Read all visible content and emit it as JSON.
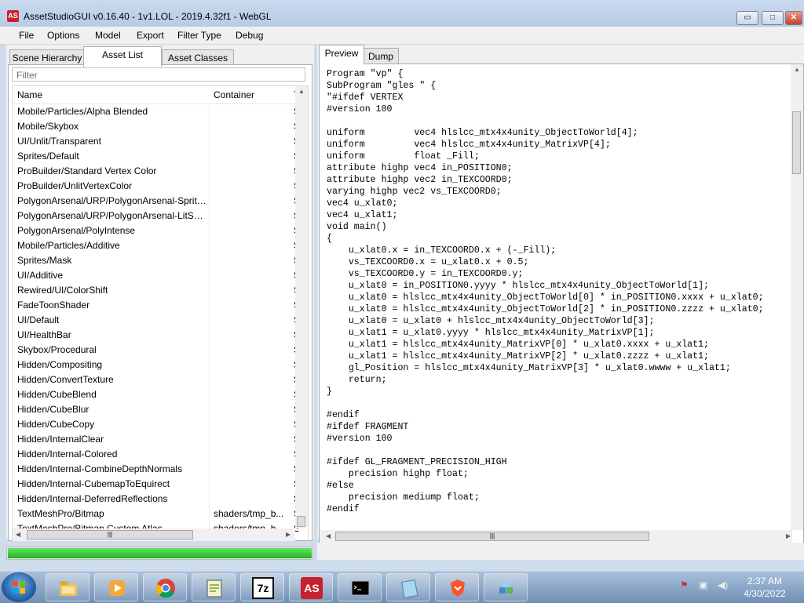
{
  "window": {
    "title": "AssetStudioGUI v0.16.40 - 1v1.LOL - 2019.4.32f1 - WebGL",
    "app_icon_text": "AS",
    "controls": {
      "minimize": "▭",
      "maximize": "□",
      "close": "✕"
    }
  },
  "menu": [
    "File",
    "Options",
    "Model",
    "Export",
    "Filter Type",
    "Debug"
  ],
  "left_tabs": [
    "Scene Hierarchy",
    "Asset List",
    "Asset Classes"
  ],
  "active_left_tab": "Asset List",
  "filter": {
    "placeholder": "Filter"
  },
  "asset_list": {
    "columns": [
      "Name",
      "Container",
      "Type"
    ],
    "rows": [
      {
        "name": "Mobile/Particles/Alpha Blended",
        "container": "",
        "type": "S"
      },
      {
        "name": "Mobile/Skybox",
        "container": "",
        "type": "S"
      },
      {
        "name": "UI/Unlit/Transparent",
        "container": "",
        "type": "S"
      },
      {
        "name": "Sprites/Default",
        "container": "",
        "type": "S"
      },
      {
        "name": "ProBuilder/Standard Vertex Color",
        "container": "",
        "type": "S"
      },
      {
        "name": "ProBuilder/UnlitVertexColor",
        "container": "",
        "type": "S"
      },
      {
        "name": "PolygonArsenal/URP/PolygonArsenal-Sprite...",
        "container": "",
        "type": "S"
      },
      {
        "name": "PolygonArsenal/URP/PolygonArsenal-LitSur...",
        "container": "",
        "type": "S"
      },
      {
        "name": "PolygonArsenal/PolyIntense",
        "container": "",
        "type": "S"
      },
      {
        "name": "Mobile/Particles/Additive",
        "container": "",
        "type": "S"
      },
      {
        "name": "Sprites/Mask",
        "container": "",
        "type": "S"
      },
      {
        "name": "UI/Additive",
        "container": "",
        "type": "S"
      },
      {
        "name": "Rewired/UI/ColorShift",
        "container": "",
        "type": "S"
      },
      {
        "name": "FadeToonShader",
        "container": "",
        "type": "S"
      },
      {
        "name": "UI/Default",
        "container": "",
        "type": "S"
      },
      {
        "name": "UI/HealthBar",
        "container": "",
        "type": "S"
      },
      {
        "name": "Skybox/Procedural",
        "container": "",
        "type": "S"
      },
      {
        "name": "Hidden/Compositing",
        "container": "",
        "type": "S"
      },
      {
        "name": "Hidden/ConvertTexture",
        "container": "",
        "type": "S"
      },
      {
        "name": "Hidden/CubeBlend",
        "container": "",
        "type": "S"
      },
      {
        "name": "Hidden/CubeBlur",
        "container": "",
        "type": "S"
      },
      {
        "name": "Hidden/CubeCopy",
        "container": "",
        "type": "S"
      },
      {
        "name": "Hidden/InternalClear",
        "container": "",
        "type": "S"
      },
      {
        "name": "Hidden/Internal-Colored",
        "container": "",
        "type": "S"
      },
      {
        "name": "Hidden/Internal-CombineDepthNormals",
        "container": "",
        "type": "S"
      },
      {
        "name": "Hidden/Internal-CubemapToEquirect",
        "container": "",
        "type": "S"
      },
      {
        "name": "Hidden/Internal-DeferredReflections",
        "container": "",
        "type": "S"
      },
      {
        "name": "TextMeshPro/Bitmap",
        "container": "shaders/tmp_b...",
        "type": "S"
      },
      {
        "name": "TextMeshPro/Bitmap Custom Atlas",
        "container": "shaders/tmp_b...",
        "type": "S"
      }
    ]
  },
  "right_tabs": [
    "Preview",
    "Dump"
  ],
  "active_right_tab": "Preview",
  "code_preview": "Program \"vp\" {\nSubProgram \"gles \" {\n\"#ifdef VERTEX\n#version 100\n\nuniform         vec4 hlslcc_mtx4x4unity_ObjectToWorld[4];\nuniform         vec4 hlslcc_mtx4x4unity_MatrixVP[4];\nuniform         float _Fill;\nattribute highp vec4 in_POSITION0;\nattribute highp vec2 in_TEXCOORD0;\nvarying highp vec2 vs_TEXCOORD0;\nvec4 u_xlat0;\nvec4 u_xlat1;\nvoid main()\n{\n    u_xlat0.x = in_TEXCOORD0.x + (-_Fill);\n    vs_TEXCOORD0.x = u_xlat0.x + 0.5;\n    vs_TEXCOORD0.y = in_TEXCOORD0.y;\n    u_xlat0 = in_POSITION0.yyyy * hlslcc_mtx4x4unity_ObjectToWorld[1];\n    u_xlat0 = hlslcc_mtx4x4unity_ObjectToWorld[0] * in_POSITION0.xxxx + u_xlat0;\n    u_xlat0 = hlslcc_mtx4x4unity_ObjectToWorld[2] * in_POSITION0.zzzz + u_xlat0;\n    u_xlat0 = u_xlat0 + hlslcc_mtx4x4unity_ObjectToWorld[3];\n    u_xlat1 = u_xlat0.yyyy * hlslcc_mtx4x4unity_MatrixVP[1];\n    u_xlat1 = hlslcc_mtx4x4unity_MatrixVP[0] * u_xlat0.xxxx + u_xlat1;\n    u_xlat1 = hlslcc_mtx4x4unity_MatrixVP[2] * u_xlat0.zzzz + u_xlat1;\n    gl_Position = hlslcc_mtx4x4unity_MatrixVP[3] * u_xlat0.wwww + u_xlat1;\n    return;\n}\n\n#endif\n#ifdef FRAGMENT\n#version 100\n\n#ifdef GL_FRAGMENT_PRECISION_HIGH\n    precision highp float;\n#else\n    precision mediump float;\n#endif",
  "progress": {
    "fraction": 1.0
  },
  "taskbar": {
    "apps": [
      "explorer-icon",
      "media-player-icon",
      "chrome-icon",
      "notepad-plus-icon",
      "7zip-icon",
      "assetstudio-icon",
      "cmd-icon",
      "notepad-icon",
      "brave-icon",
      "package-icon"
    ],
    "app_7z_text": "7z",
    "app_as_text": "AS",
    "clock_time": "2:37 AM",
    "clock_date": "4/30/2022"
  },
  "colors": {
    "progress_green": "#22b422",
    "selection": "#cfe0f4"
  }
}
